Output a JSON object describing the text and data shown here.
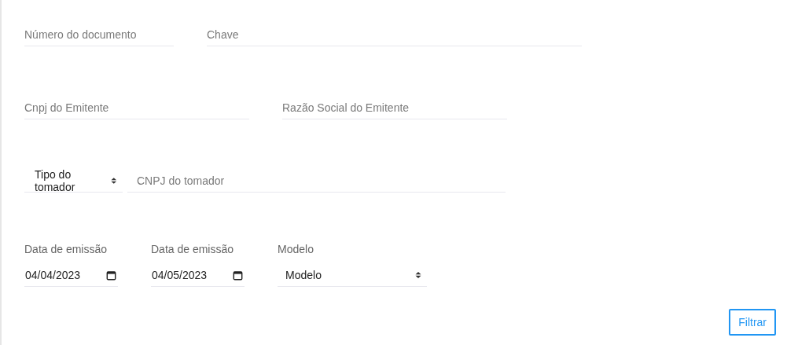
{
  "rows": [
    [
      {
        "kind": "text",
        "placeholder": "Número do documento"
      },
      {
        "kind": "text",
        "placeholder": "Chave"
      }
    ],
    [
      {
        "kind": "text",
        "placeholder": "Cnpj do Emitente"
      },
      {
        "kind": "text",
        "placeholder": "Razão Social do Emitente"
      }
    ],
    [
      {
        "kind": "select",
        "value": "Tipo do tomador"
      },
      {
        "kind": "text",
        "placeholder": "CNPJ do tomador"
      }
    ],
    [
      {
        "kind": "date",
        "label": "Data de emissão",
        "value": "04/04/2023"
      },
      {
        "kind": "date",
        "label": "Data de emissão",
        "value": "04/05/2023"
      },
      {
        "kind": "select",
        "label": "Modelo",
        "value": "Modelo"
      }
    ]
  ],
  "button": "Filtrar"
}
